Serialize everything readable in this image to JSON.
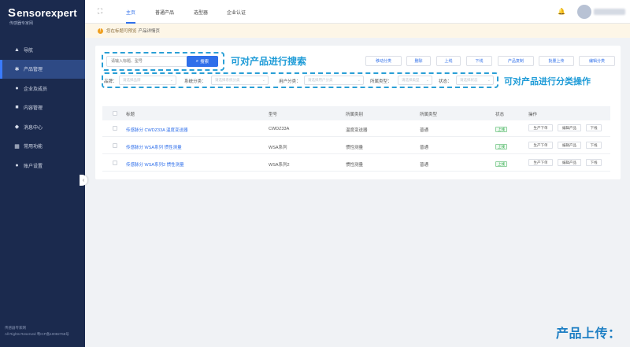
{
  "brand": {
    "logo_text": "ensorexpert",
    "logo_initial": "S",
    "logo_sub": "传感器专家网"
  },
  "sidebar": {
    "items": [
      {
        "label": "导航",
        "icon": "navigation-icon",
        "active": false
      },
      {
        "label": "产品管理",
        "icon": "gear-icon",
        "active": true
      },
      {
        "label": "企业及成员",
        "icon": "users-icon",
        "active": false
      },
      {
        "label": "内容管理",
        "icon": "document-icon",
        "active": false
      },
      {
        "label": "消息中心",
        "icon": "message-icon",
        "active": false
      },
      {
        "label": "常用功能",
        "icon": "grid-icon",
        "active": false
      },
      {
        "label": "账户设置",
        "icon": "user-icon",
        "active": false
      }
    ],
    "footer_line1": "传感器专家网",
    "footer_line2": "All Rights Reserved 粤ICP备10082768号"
  },
  "topbar": {
    "tabs": [
      {
        "label": "主页",
        "active": true
      },
      {
        "label": "普通产品",
        "active": false
      },
      {
        "label": "选型器",
        "active": false
      },
      {
        "label": "企业认证",
        "active": false
      }
    ]
  },
  "notice": {
    "prefix": "您在标题可预览",
    "highlight": "产品详情页"
  },
  "search": {
    "placeholder": "请输入标题、型号",
    "button_label": "搜索"
  },
  "annotations": {
    "search": "可对产品进行搜索",
    "filter": "可对产品进行分类操作",
    "upload": "产品上传："
  },
  "toolbar": {
    "buttons": [
      "移动分类",
      "删除",
      "上线",
      "下线",
      "产品复制",
      "批量上传",
      "编辑分类"
    ]
  },
  "filters": [
    {
      "label": "品牌：",
      "placeholder": "请选择品牌"
    },
    {
      "label": "系统分类：",
      "placeholder": "请选择系统分类"
    },
    {
      "label": "用户分类：",
      "placeholder": "请选择用户分类"
    },
    {
      "label": "所属类型：",
      "placeholder": "请选择类型"
    },
    {
      "label": "状态：",
      "placeholder": "请选择状态"
    }
  ],
  "table": {
    "headers": [
      "标题",
      "型号",
      "所属类别",
      "所属类型",
      "状态",
      "操作"
    ],
    "rows": [
      {
        "title": "传感脉分 CWDZ33A 温度变送器",
        "model": "CWDZ33A",
        "category": "温度变送器",
        "type": "普通",
        "status": "上线"
      },
      {
        "title": "传感脉分 WSA系列 惯性测量",
        "model": "WSA系列",
        "category": "惯性测量",
        "type": "普通",
        "status": "上线"
      },
      {
        "title": "传感脉分 WSA系列2 惯性测量",
        "model": "WSA系列2",
        "category": "惯性测量",
        "type": "普通",
        "status": "上线"
      }
    ],
    "row_actions": [
      "生产下单",
      "编辑产品",
      "下线"
    ]
  },
  "colors": {
    "sidebar_bg": "#1b2a4e",
    "accent": "#2f6fea",
    "annotation": "#1e9bd7",
    "status_ok": "#27a844"
  }
}
